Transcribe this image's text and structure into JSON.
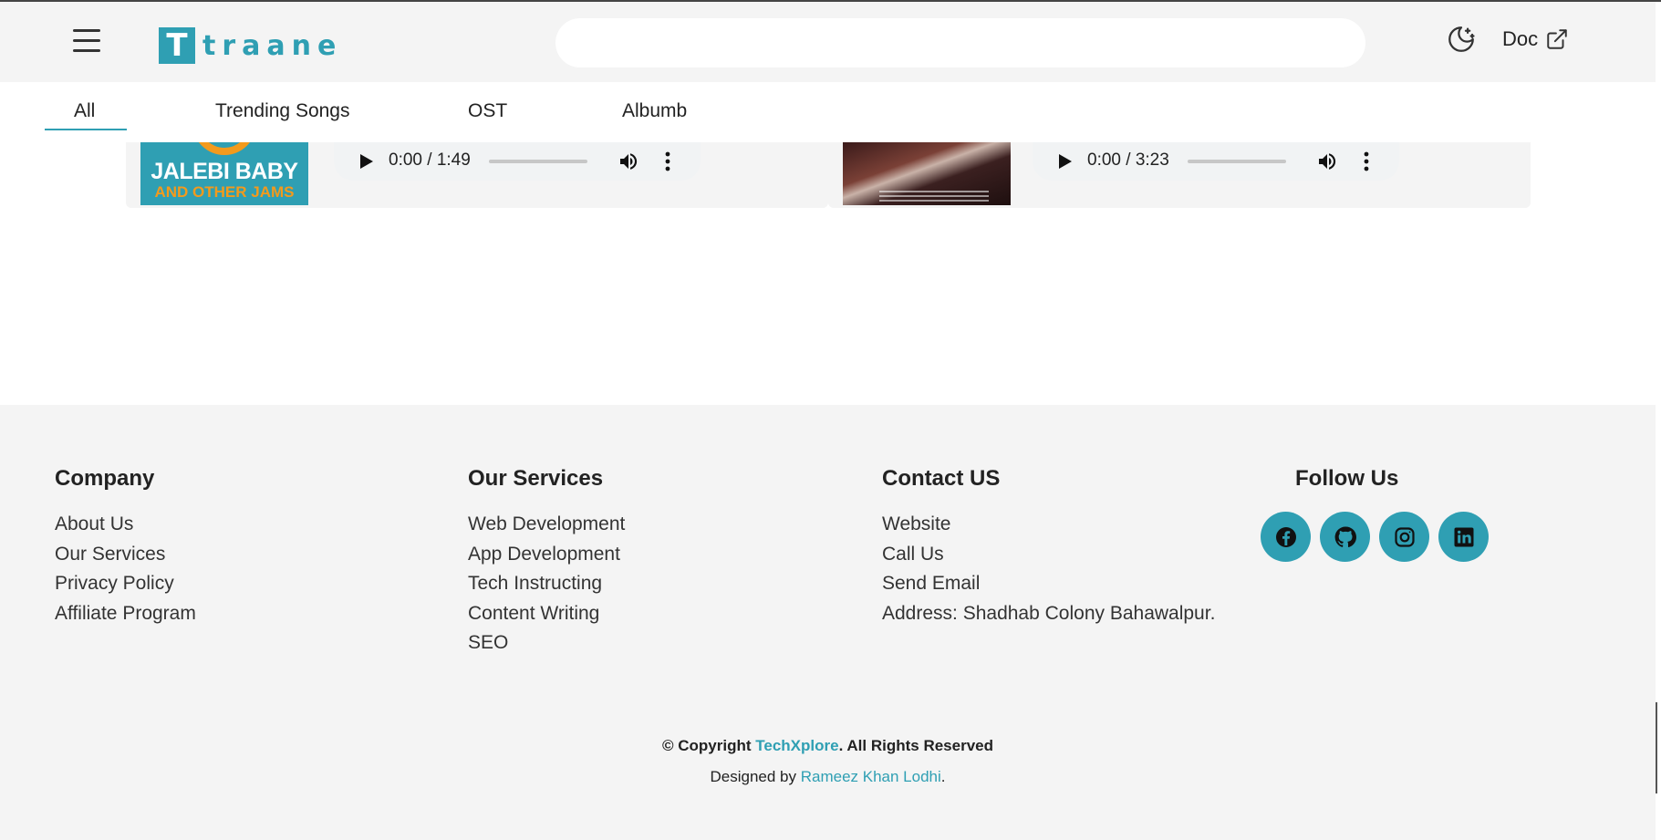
{
  "header": {
    "logo_letter": "T",
    "logo_text": "traane",
    "search_placeholder": "",
    "doc_label": "Doc"
  },
  "tabs": [
    {
      "label": "All",
      "active": true
    },
    {
      "label": "Trending Songs",
      "active": false
    },
    {
      "label": "OST",
      "active": false
    },
    {
      "label": "Albumb",
      "active": false
    }
  ],
  "songs": [
    {
      "cover_title": "JALEBI BABY",
      "cover_subtitle": "AND OTHER JAMS",
      "time": "0:00 / 1:49"
    },
    {
      "time": "0:00 / 3:23"
    }
  ],
  "footer": {
    "columns": [
      {
        "title": "Company",
        "links": [
          "About Us",
          "Our Services",
          "Privacy Policy",
          "Affiliate Program"
        ]
      },
      {
        "title": "Our Services",
        "links": [
          "Web Development",
          "App Development",
          "Tech Instructing",
          "Content Writing",
          "SEO"
        ]
      },
      {
        "title": "Contact US",
        "links": [
          "Website",
          "Call Us",
          "Send Email",
          "Address: Shadhab Colony Bahawalpur."
        ]
      },
      {
        "title": "Follow Us",
        "links": []
      }
    ],
    "social": [
      "facebook-icon",
      "github-icon",
      "instagram-icon",
      "linkedin-icon"
    ],
    "copyright_prefix": "© Copyright ",
    "copyright_brand": "TechXplore",
    "copyright_suffix": ". All Rights Reserved",
    "designed_prefix": "Designed by ",
    "designed_author": "Rameez Khan Lodhi",
    "designed_suffix": "."
  },
  "colors": {
    "accent": "#2f9fb3",
    "header_bg": "#f4f4f4",
    "footer_bg": "#f4f4f4",
    "cover_orange": "#f39a1c"
  }
}
